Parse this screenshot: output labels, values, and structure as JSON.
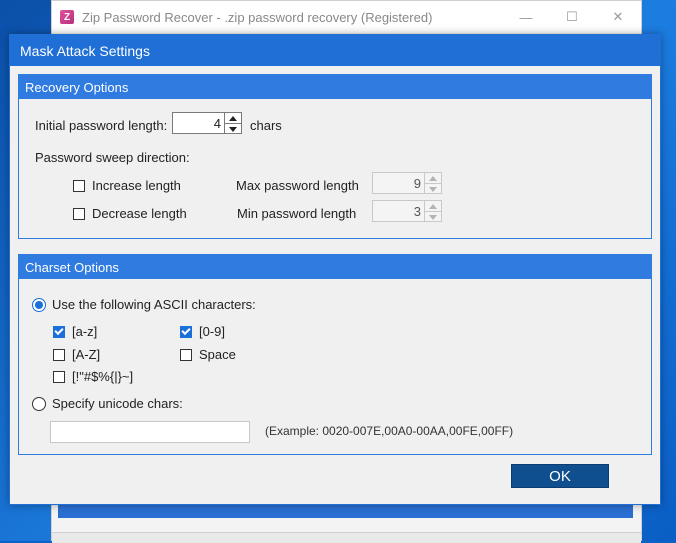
{
  "parent_window": {
    "title": "Zip Password Recover - .zip password recovery (Registered)",
    "app_icon_letter": "Z",
    "controls": [
      "—",
      "☐",
      "✕"
    ]
  },
  "dialog": {
    "title": "Mask Attack Settings",
    "recovery": {
      "header": "Recovery Options",
      "initial_length_label": "Initial password length:",
      "initial_length_value": "4",
      "chars_label": "chars",
      "sweep_label": "Password sweep direction:",
      "increase_label": "Increase length",
      "decrease_label": "Decrease length",
      "increase_checked": false,
      "decrease_checked": false,
      "max_label": "Max password length",
      "max_value": "9",
      "min_label": "Min password length",
      "min_value": "3"
    },
    "charset": {
      "header": "Charset Options",
      "ascii_radio_label": "Use the following ASCII characters:",
      "ascii_selected": true,
      "lower_label": "[a-z]",
      "lower_checked": true,
      "digits_label": "[0-9]",
      "digits_checked": true,
      "upper_label": "[A-Z]",
      "upper_checked": false,
      "space_label": "Space",
      "space_checked": false,
      "symbols_label": "[!\"#$%{|}~]",
      "symbols_checked": false,
      "unicode_radio_label": "Specify unicode chars:",
      "unicode_value": "",
      "example_text": "(Example: 0020-007E,00A0-00AA,00FE,00FF)"
    },
    "ok_label": "OK"
  },
  "colors": {
    "accent": "#1f6fd6",
    "group_header": "#2f7be0",
    "ok_button": "#0f4f8f"
  }
}
